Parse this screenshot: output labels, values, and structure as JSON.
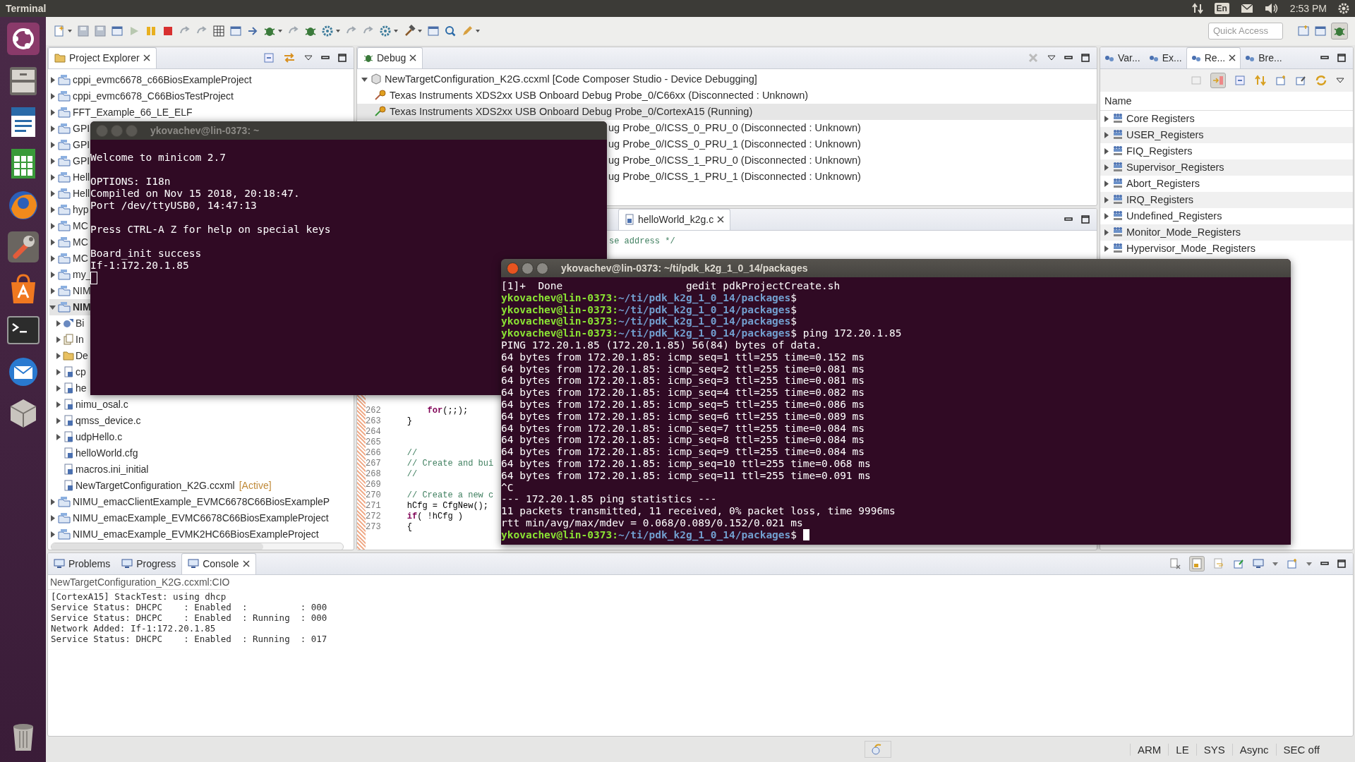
{
  "top_bar": {
    "app_name": "Terminal",
    "keyboard": "En",
    "time": "2:53 PM"
  },
  "toolbar": {
    "quick_access": {
      "placeholder": "Quick Access"
    }
  },
  "project_explorer": {
    "title": "Project Explorer",
    "items": [
      {
        "label": "cppi_evmc6678_c66BiosExampleProject",
        "kind": "project",
        "expanded": false,
        "selected": false
      },
      {
        "label": "cppi_evmc6678_C66BiosTestProject",
        "kind": "project",
        "expanded": false,
        "selected": false
      },
      {
        "label": "FFT_Example_66_LE_ELF",
        "kind": "project",
        "expanded": false,
        "selected": false
      },
      {
        "label": "GPI",
        "kind": "project",
        "expanded": false,
        "selected": false
      },
      {
        "label": "GPI",
        "kind": "project",
        "expanded": false,
        "selected": false
      },
      {
        "label": "GPI",
        "kind": "project",
        "expanded": false,
        "selected": false
      },
      {
        "label": "Hell",
        "kind": "project",
        "expanded": false,
        "selected": false
      },
      {
        "label": "Hell",
        "kind": "project",
        "expanded": false,
        "selected": false
      },
      {
        "label": "hyp",
        "kind": "project",
        "expanded": false,
        "selected": false
      },
      {
        "label": "MC",
        "kind": "project",
        "expanded": false,
        "selected": false
      },
      {
        "label": "MC",
        "kind": "project",
        "expanded": false,
        "selected": false
      },
      {
        "label": "MC",
        "kind": "project",
        "expanded": false,
        "selected": false
      },
      {
        "label": "my_",
        "kind": "project",
        "expanded": false,
        "selected": false
      },
      {
        "label": "NIM",
        "kind": "project",
        "expanded": false,
        "selected": false
      },
      {
        "label": "NIM",
        "kind": "project",
        "expanded": true,
        "selected": true,
        "children": [
          {
            "label": "Bi",
            "kind": "binaries",
            "expanded": false,
            "selected": false
          },
          {
            "label": "In",
            "kind": "includes",
            "expanded": false,
            "selected": false
          },
          {
            "label": "De",
            "kind": "folder",
            "expanded": false,
            "selected": false
          },
          {
            "label": "cp",
            "kind": "source",
            "expanded": false,
            "selected": false
          },
          {
            "label": "he",
            "kind": "source",
            "expanded": false,
            "selected": false
          },
          {
            "label": "nimu_osal.c",
            "kind": "source",
            "expanded": false,
            "selected": false
          },
          {
            "label": "qmss_device.c",
            "kind": "source",
            "expanded": false,
            "selected": false
          },
          {
            "label": "udpHello.c",
            "kind": "source",
            "expanded": false,
            "selected": false
          },
          {
            "label": "helloWorld.cfg",
            "kind": "file",
            "selected": false
          },
          {
            "label": "macros.ini_initial",
            "kind": "file",
            "selected": false
          },
          {
            "label": "NewTargetConfiguration_K2G.ccxml",
            "tag": "[Active]",
            "kind": "target",
            "selected": false
          }
        ]
      },
      {
        "label": "NIMU_emacClientExample_EVMC6678C66BiosExampleP",
        "kind": "project",
        "expanded": false,
        "selected": false
      },
      {
        "label": "NIMU_emacExample_EVMC6678C66BiosExampleProject",
        "kind": "project",
        "expanded": false,
        "selected": false
      },
      {
        "label": "NIMU_emacExample_EVMK2HC66BiosExampleProject",
        "kind": "project",
        "expanded": false,
        "selected": false
      }
    ]
  },
  "debug": {
    "title": "Debug",
    "root": {
      "label": "NewTargetConfiguration_K2G.ccxml [Code Composer Studio - Device Debugging]",
      "expanded": true,
      "children": [
        {
          "label": "Texas Instruments XDS2xx USB Onboard Debug Probe_0/C66xx (Disconnected : Unknown)",
          "kind": "disconnected",
          "selected": false
        },
        {
          "label": "Texas Instruments XDS2xx USB Onboard Debug Probe_0/CortexA15 (Running)",
          "kind": "running",
          "selected": true
        },
        {
          "label": "ug Probe_0/ICSS_0_PRU_0 (Disconnected : Unknown)",
          "kind": "covered",
          "selected": false
        },
        {
          "label": "ug Probe_0/ICSS_0_PRU_1 (Disconnected : Unknown)",
          "kind": "covered",
          "selected": false
        },
        {
          "label": "ug Probe_0/ICSS_1_PRU_0 (Disconnected : Unknown)",
          "kind": "covered",
          "selected": false
        },
        {
          "label": "ug Probe_0/ICSS_1_PRU_1 (Disconnected : Unknown)",
          "kind": "covered",
          "selected": false
        }
      ]
    }
  },
  "editor": {
    "tab": "helloWorld_k2g.c",
    "partial_line": "se address */",
    "lines": [
      {
        "number": "262",
        "code": "        **for**(;;);",
        "kind": "code"
      },
      {
        "number": "263",
        "code": "    }",
        "kind": "code"
      },
      {
        "number": "264",
        "kind": "blank"
      },
      {
        "number": "265",
        "kind": "blank"
      },
      {
        "number": "266",
        "code": "    //",
        "kind": "comment"
      },
      {
        "number": "267",
        "code": "    // Create and bui",
        "kind": "comment"
      },
      {
        "number": "268",
        "code": "    //",
        "kind": "comment"
      },
      {
        "number": "269",
        "kind": "blank"
      },
      {
        "number": "270",
        "code": "    // Create a new c",
        "kind": "comment"
      },
      {
        "number": "271",
        "code": "    hCfg = CfgNew();",
        "kind": "code"
      },
      {
        "number": "272",
        "code": "    **if**( !hCfg )",
        "kind": "code"
      },
      {
        "number": "273",
        "code": "    {",
        "kind": "code"
      }
    ]
  },
  "registers": {
    "tabs": [
      {
        "label": "Var...",
        "selected": false
      },
      {
        "label": "Ex...",
        "selected": false
      },
      {
        "label": "Re...",
        "selected": true
      },
      {
        "label": "Bre...",
        "selected": false
      }
    ],
    "column": "Name",
    "groups": [
      {
        "label": "Core Registers",
        "expanded": false
      },
      {
        "label": "USER_Registers",
        "expanded": false
      },
      {
        "label": "FIQ_Registers",
        "expanded": false
      },
      {
        "label": "Supervisor_Registers",
        "expanded": false
      },
      {
        "label": "Abort_Registers",
        "expanded": false
      },
      {
        "label": "IRQ_Registers",
        "expanded": false
      },
      {
        "label": "Undefined_Registers",
        "expanded": false
      },
      {
        "label": "Monitor_Mode_Registers",
        "expanded": false
      },
      {
        "label": "Hypervisor_Mode_Registers",
        "expanded": false
      }
    ]
  },
  "console": {
    "tabs": [
      {
        "label": "Problems",
        "selected": false
      },
      {
        "label": "Progress",
        "selected": false
      },
      {
        "label": "Console",
        "selected": true
      }
    ],
    "header": "NewTargetConfiguration_K2G.ccxml:CIO",
    "lines": [
      "[CortexA15] StackTest: using dhcp",
      "Service Status: DHCPC    : Enabled  :          : 000",
      "Service Status: DHCPC    : Enabled  : Running  : 000",
      "Network Added: If-1:172.20.1.85",
      "Service Status: DHCPC    : Enabled  : Running  : 017"
    ]
  },
  "status_bar": [
    "ARM",
    "LE",
    "SYS",
    "Async",
    "SEC off"
  ],
  "minicom": {
    "title": "ykovachev@lin-0373: ~",
    "active": false,
    "blocks": [
      [
        "Welcome to minicom 2.7"
      ],
      [
        "OPTIONS: I18n",
        "Compiled on Nov 15 2018, 20:18:47.",
        "Port /dev/ttyUSB0, 14:47:13"
      ],
      [
        "Press CTRL-A Z for help on special keys"
      ],
      [
        "Board_init success",
        "If-1:172.20.1.85"
      ]
    ]
  },
  "terminal": {
    "title": "ykovachev@lin-0373: ~/ti/pdk_k2g_1_0_14/packages",
    "active": true,
    "lines": [
      {
        "kind": "output",
        "text": "[1]+  Done                    gedit pdkProjectCreate.sh"
      },
      {
        "kind": "prompt",
        "user": "ykovachev@lin-0373:",
        "path": "~/ti/pdk_k2g_1_0_14/packages",
        "tail": "$"
      },
      {
        "kind": "prompt",
        "user": "ykovachev@lin-0373:",
        "path": "~/ti/pdk_k2g_1_0_14/packages",
        "tail": "$"
      },
      {
        "kind": "prompt",
        "user": "ykovachev@lin-0373:",
        "path": "~/ti/pdk_k2g_1_0_14/packages",
        "tail": "$"
      },
      {
        "kind": "prompt",
        "user": "ykovachev@lin-0373:",
        "path": "~/ti/pdk_k2g_1_0_14/packages",
        "tail": "$ ping 172.20.1.85"
      },
      {
        "kind": "output",
        "text": "PING 172.20.1.85 (172.20.1.85) 56(84) bytes of data."
      },
      {
        "kind": "output",
        "text": "64 bytes from 172.20.1.85: icmp_seq=1 ttl=255 time=0.152 ms"
      },
      {
        "kind": "output",
        "text": "64 bytes from 172.20.1.85: icmp_seq=2 ttl=255 time=0.081 ms"
      },
      {
        "kind": "output",
        "text": "64 bytes from 172.20.1.85: icmp_seq=3 ttl=255 time=0.081 ms"
      },
      {
        "kind": "output",
        "text": "64 bytes from 172.20.1.85: icmp_seq=4 ttl=255 time=0.082 ms"
      },
      {
        "kind": "output",
        "text": "64 bytes from 172.20.1.85: icmp_seq=5 ttl=255 time=0.086 ms"
      },
      {
        "kind": "output",
        "text": "64 bytes from 172.20.1.85: icmp_seq=6 ttl=255 time=0.089 ms"
      },
      {
        "kind": "output",
        "text": "64 bytes from 172.20.1.85: icmp_seq=7 ttl=255 time=0.084 ms"
      },
      {
        "kind": "output",
        "text": "64 bytes from 172.20.1.85: icmp_seq=8 ttl=255 time=0.084 ms"
      },
      {
        "kind": "output",
        "text": "64 bytes from 172.20.1.85: icmp_seq=9 ttl=255 time=0.084 ms"
      },
      {
        "kind": "output",
        "text": "64 bytes from 172.20.1.85: icmp_seq=10 ttl=255 time=0.068 ms"
      },
      {
        "kind": "output",
        "text": "64 bytes from 172.20.1.85: icmp_seq=11 ttl=255 time=0.091 ms"
      },
      {
        "kind": "output",
        "text": "^C"
      },
      {
        "kind": "output",
        "text": "--- 172.20.1.85 ping statistics ---"
      },
      {
        "kind": "output",
        "text": "11 packets transmitted, 11 received, 0% packet loss, time 9996ms"
      },
      {
        "kind": "output",
        "text": "rtt min/avg/max/mdev = 0.068/0.089/0.152/0.021 ms"
      },
      {
        "kind": "prompt",
        "user": "ykovachev@lin-0373:",
        "path": "~/ti/pdk_k2g_1_0_14/packages",
        "tail": "$"
      }
    ]
  }
}
